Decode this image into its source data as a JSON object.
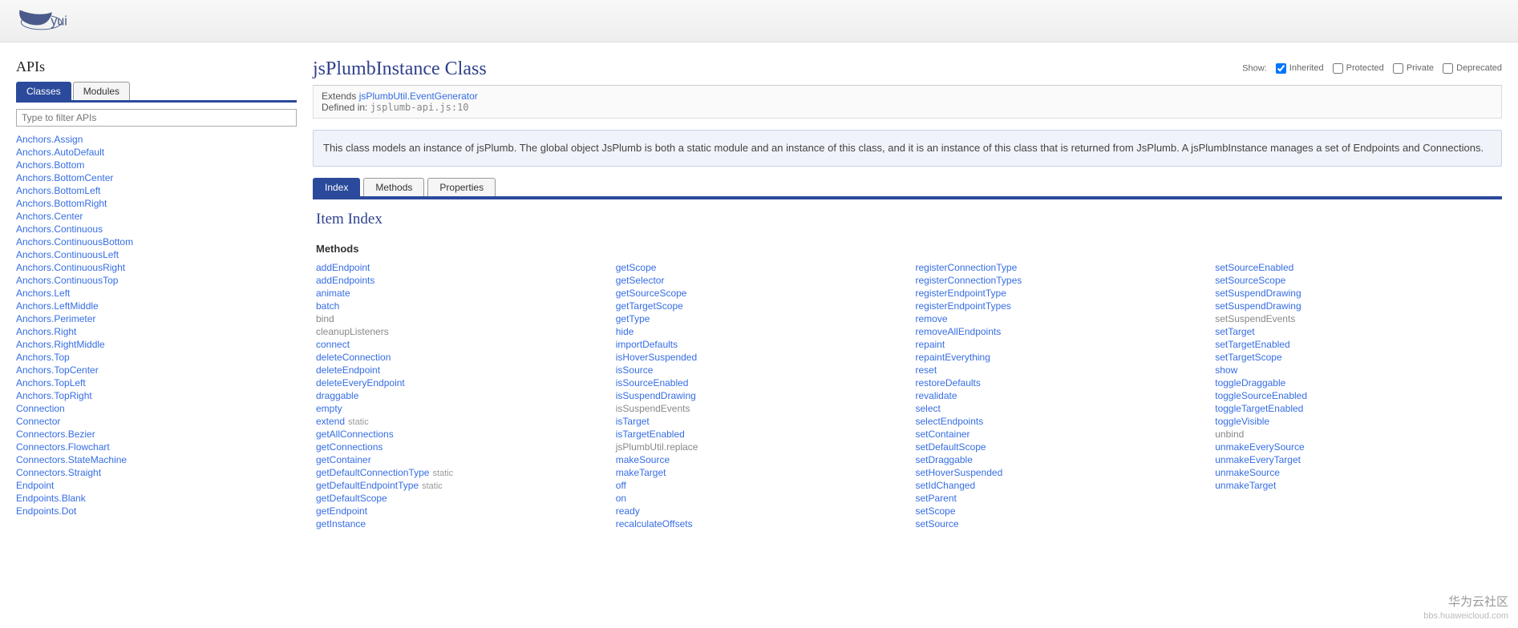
{
  "header": {
    "right_text": ""
  },
  "sidebar": {
    "title": "APIs",
    "tabs": [
      {
        "label": "Classes",
        "active": true
      },
      {
        "label": "Modules",
        "active": false
      }
    ],
    "filter_placeholder": "Type to filter APIs",
    "items": [
      "Anchors.Assign",
      "Anchors.AutoDefault",
      "Anchors.Bottom",
      "Anchors.BottomCenter",
      "Anchors.BottomLeft",
      "Anchors.BottomRight",
      "Anchors.Center",
      "Anchors.Continuous",
      "Anchors.ContinuousBottom",
      "Anchors.ContinuousLeft",
      "Anchors.ContinuousRight",
      "Anchors.ContinuousTop",
      "Anchors.Left",
      "Anchors.LeftMiddle",
      "Anchors.Perimeter",
      "Anchors.Right",
      "Anchors.RightMiddle",
      "Anchors.Top",
      "Anchors.TopCenter",
      "Anchors.TopLeft",
      "Anchors.TopRight",
      "Connection",
      "Connector",
      "Connectors.Bezier",
      "Connectors.Flowchart",
      "Connectors.StateMachine",
      "Connectors.Straight",
      "Endpoint",
      "Endpoints.Blank",
      "Endpoints.Dot"
    ]
  },
  "main": {
    "title": "jsPlumbInstance Class",
    "show": {
      "label": "Show:",
      "inherited": "Inherited",
      "protected": "Protected",
      "private": "Private",
      "deprecated": "Deprecated"
    },
    "meta": {
      "extends_label": "Extends ",
      "extends_link": "jsPlumbUtil.EventGenerator",
      "defined_label": "Defined in: ",
      "defined_in": "jsplumb-api.js:10"
    },
    "description": "This class models an instance of jsPlumb. The global object JsPlumb is both a static module and an instance of this class, and it is an instance of this class that is returned from JsPlumb. A jsPlumbInstance manages a set of Endpoints and Connections.",
    "content_tabs": [
      {
        "label": "Index",
        "active": true
      },
      {
        "label": "Methods",
        "active": false
      },
      {
        "label": "Properties",
        "active": false
      }
    ],
    "item_index_title": "Item Index",
    "methods_heading": "Methods",
    "methods": [
      {
        "name": "addEndpoint"
      },
      {
        "name": "addEndpoints"
      },
      {
        "name": "animate"
      },
      {
        "name": "batch"
      },
      {
        "name": "bind",
        "muted": true
      },
      {
        "name": "cleanupListeners",
        "muted": true
      },
      {
        "name": "connect"
      },
      {
        "name": "deleteConnection"
      },
      {
        "name": "deleteEndpoint"
      },
      {
        "name": "deleteEveryEndpoint"
      },
      {
        "name": "draggable"
      },
      {
        "name": "empty"
      },
      {
        "name": "extend",
        "static": true
      },
      {
        "name": "getAllConnections"
      },
      {
        "name": "getConnections"
      },
      {
        "name": "getContainer"
      },
      {
        "name": "getDefaultConnectionType",
        "static": true
      },
      {
        "name": "getDefaultEndpointType",
        "static": true
      },
      {
        "name": "getDefaultScope"
      },
      {
        "name": "getEndpoint"
      },
      {
        "name": "getInstance"
      },
      {
        "name": "getScope"
      },
      {
        "name": "getSelector"
      },
      {
        "name": "getSourceScope"
      },
      {
        "name": "getTargetScope"
      },
      {
        "name": "getType"
      },
      {
        "name": "hide"
      },
      {
        "name": "importDefaults"
      },
      {
        "name": "isHoverSuspended"
      },
      {
        "name": "isSource"
      },
      {
        "name": "isSourceEnabled"
      },
      {
        "name": "isSuspendDrawing"
      },
      {
        "name": "isSuspendEvents",
        "muted": true
      },
      {
        "name": "isTarget"
      },
      {
        "name": "isTargetEnabled"
      },
      {
        "name": "jsPlumbUtil.replace",
        "muted": true
      },
      {
        "name": "makeSource"
      },
      {
        "name": "makeTarget"
      },
      {
        "name": "off"
      },
      {
        "name": "on"
      },
      {
        "name": "ready"
      },
      {
        "name": "recalculateOffsets"
      },
      {
        "name": "registerConnectionType"
      },
      {
        "name": "registerConnectionTypes"
      },
      {
        "name": "registerEndpointType"
      },
      {
        "name": "registerEndpointTypes"
      },
      {
        "name": "remove"
      },
      {
        "name": "removeAllEndpoints"
      },
      {
        "name": "repaint"
      },
      {
        "name": "repaintEverything"
      },
      {
        "name": "reset"
      },
      {
        "name": "restoreDefaults"
      },
      {
        "name": "revalidate"
      },
      {
        "name": "select"
      },
      {
        "name": "selectEndpoints"
      },
      {
        "name": "setContainer"
      },
      {
        "name": "setDefaultScope"
      },
      {
        "name": "setDraggable"
      },
      {
        "name": "setHoverSuspended"
      },
      {
        "name": "setIdChanged"
      },
      {
        "name": "setParent"
      },
      {
        "name": "setScope"
      },
      {
        "name": "setSource"
      },
      {
        "name": "setSourceEnabled"
      },
      {
        "name": "setSourceScope"
      },
      {
        "name": "setSuspendDrawing"
      },
      {
        "name": "setSuspendDrawing"
      },
      {
        "name": "setSuspendEvents",
        "muted": true
      },
      {
        "name": "setTarget"
      },
      {
        "name": "setTargetEnabled"
      },
      {
        "name": "setTargetScope"
      },
      {
        "name": "show"
      },
      {
        "name": "toggleDraggable"
      },
      {
        "name": "toggleSourceEnabled"
      },
      {
        "name": "toggleTargetEnabled"
      },
      {
        "name": "toggleVisible"
      },
      {
        "name": "unbind",
        "muted": true
      },
      {
        "name": "unmakeEverySource"
      },
      {
        "name": "unmakeEveryTarget"
      },
      {
        "name": "unmakeSource"
      },
      {
        "name": "unmakeTarget"
      }
    ],
    "static_label": "static"
  },
  "watermark": {
    "line1": "华为云社区",
    "line2": "bbs.huaweicloud.com"
  }
}
